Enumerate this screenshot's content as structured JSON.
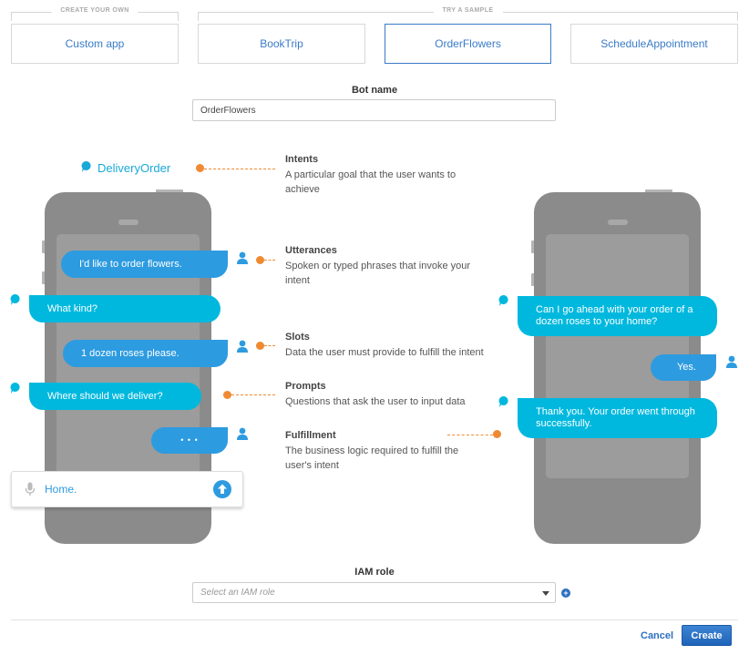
{
  "groups": {
    "create_your_own": "CREATE YOUR OWN",
    "try_a_sample": "TRY A SAMPLE"
  },
  "tiles": [
    {
      "label": "Custom app",
      "selected": false
    },
    {
      "label": "BookTrip",
      "selected": false
    },
    {
      "label": "OrderFlowers",
      "selected": true
    },
    {
      "label": "ScheduleAppointment",
      "selected": false
    }
  ],
  "bot_name": {
    "label": "Bot name",
    "value": "OrderFlowers"
  },
  "illustration": {
    "intent_name": "DeliveryOrder",
    "left_chat": {
      "messages": [
        {
          "from": "user",
          "text": "I'd like to order flowers."
        },
        {
          "from": "bot",
          "text": "What kind?"
        },
        {
          "from": "user",
          "text": "1 dozen roses please."
        },
        {
          "from": "bot",
          "text": "Where should we deliver?"
        },
        {
          "from": "user",
          "text": "• • •"
        }
      ],
      "input_value": "Home."
    },
    "right_chat": {
      "messages": [
        {
          "from": "bot",
          "text": "Can I go ahead with your order of a dozen roses to your home?"
        },
        {
          "from": "user",
          "text": "Yes."
        },
        {
          "from": "bot",
          "text": "Thank you. Your order went through successfully."
        }
      ]
    },
    "annotations": [
      {
        "title": "Intents",
        "description": "A particular goal that the user wants to achieve"
      },
      {
        "title": "Utterances",
        "description": "Spoken or typed phrases that invoke your intent"
      },
      {
        "title": "Slots",
        "description": "Data the user must provide to fulfill the intent"
      },
      {
        "title": "Prompts",
        "description": "Questions that ask the user to input data"
      },
      {
        "title": "Fulfillment",
        "description": "The business logic required to fulfill the user's intent"
      }
    ],
    "colors": {
      "bot_bubble": "#00b8de",
      "user_bubble": "#2d9be0",
      "connector": "#ef8a33",
      "phone": "#8b8b8b"
    }
  },
  "iam_role": {
    "label": "IAM role",
    "placeholder": "Select an IAM role",
    "add_icon": "plus-circle-icon"
  },
  "footer": {
    "cancel_label": "Cancel",
    "create_label": "Create"
  }
}
